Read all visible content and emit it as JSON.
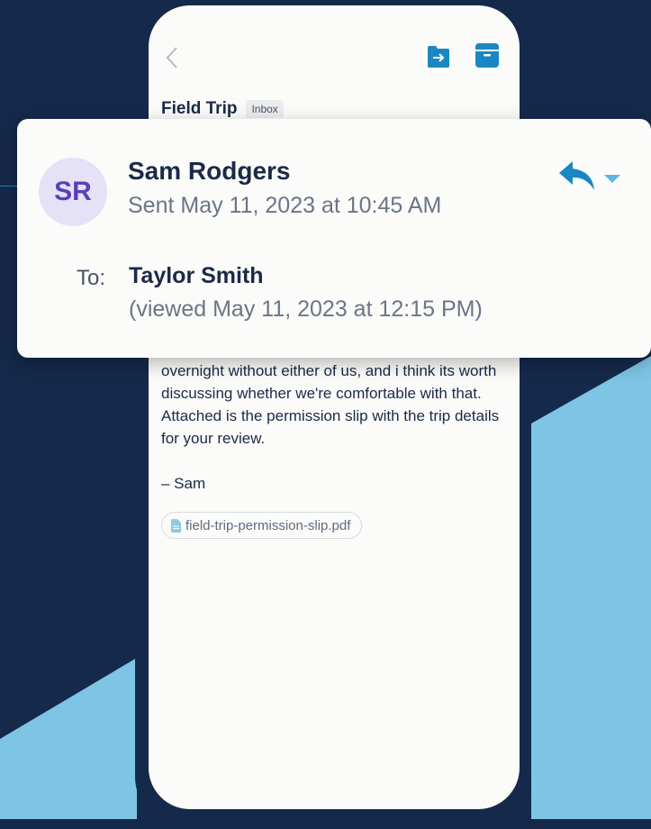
{
  "email": {
    "subject": "Field Trip",
    "folder_tag": "Inbox",
    "body": "overnight without either of us, and i think its worth discussing whether we're comfortable with that. Attached is the permission slip with the trip details for your review.",
    "signature": "– Sam",
    "attachment": {
      "filename": "field-trip-permission-slip.pdf",
      "icon": "pdf-file-icon"
    }
  },
  "header_card": {
    "avatar_initials": "SR",
    "sender_name": "Sam Rodgers",
    "sent": "Sent May 11, 2023 at 10:45 AM",
    "to_label": "To:",
    "recipient": "Taylor Smith",
    "viewed": "(viewed May 11, 2023 at 12:15 PM)"
  },
  "toolbar": {
    "icons": [
      "back-chevron-icon",
      "move-to-folder-icon",
      "archive-icon"
    ]
  },
  "actions": {
    "icons": [
      "reply-icon",
      "chevron-down-icon"
    ]
  },
  "colors": {
    "background_dark": "#15294a",
    "background_light": "#7ec4e4",
    "accent": "#1a87c4",
    "avatar_bg": "#e5e1f6",
    "avatar_text": "#5a3fb8"
  }
}
